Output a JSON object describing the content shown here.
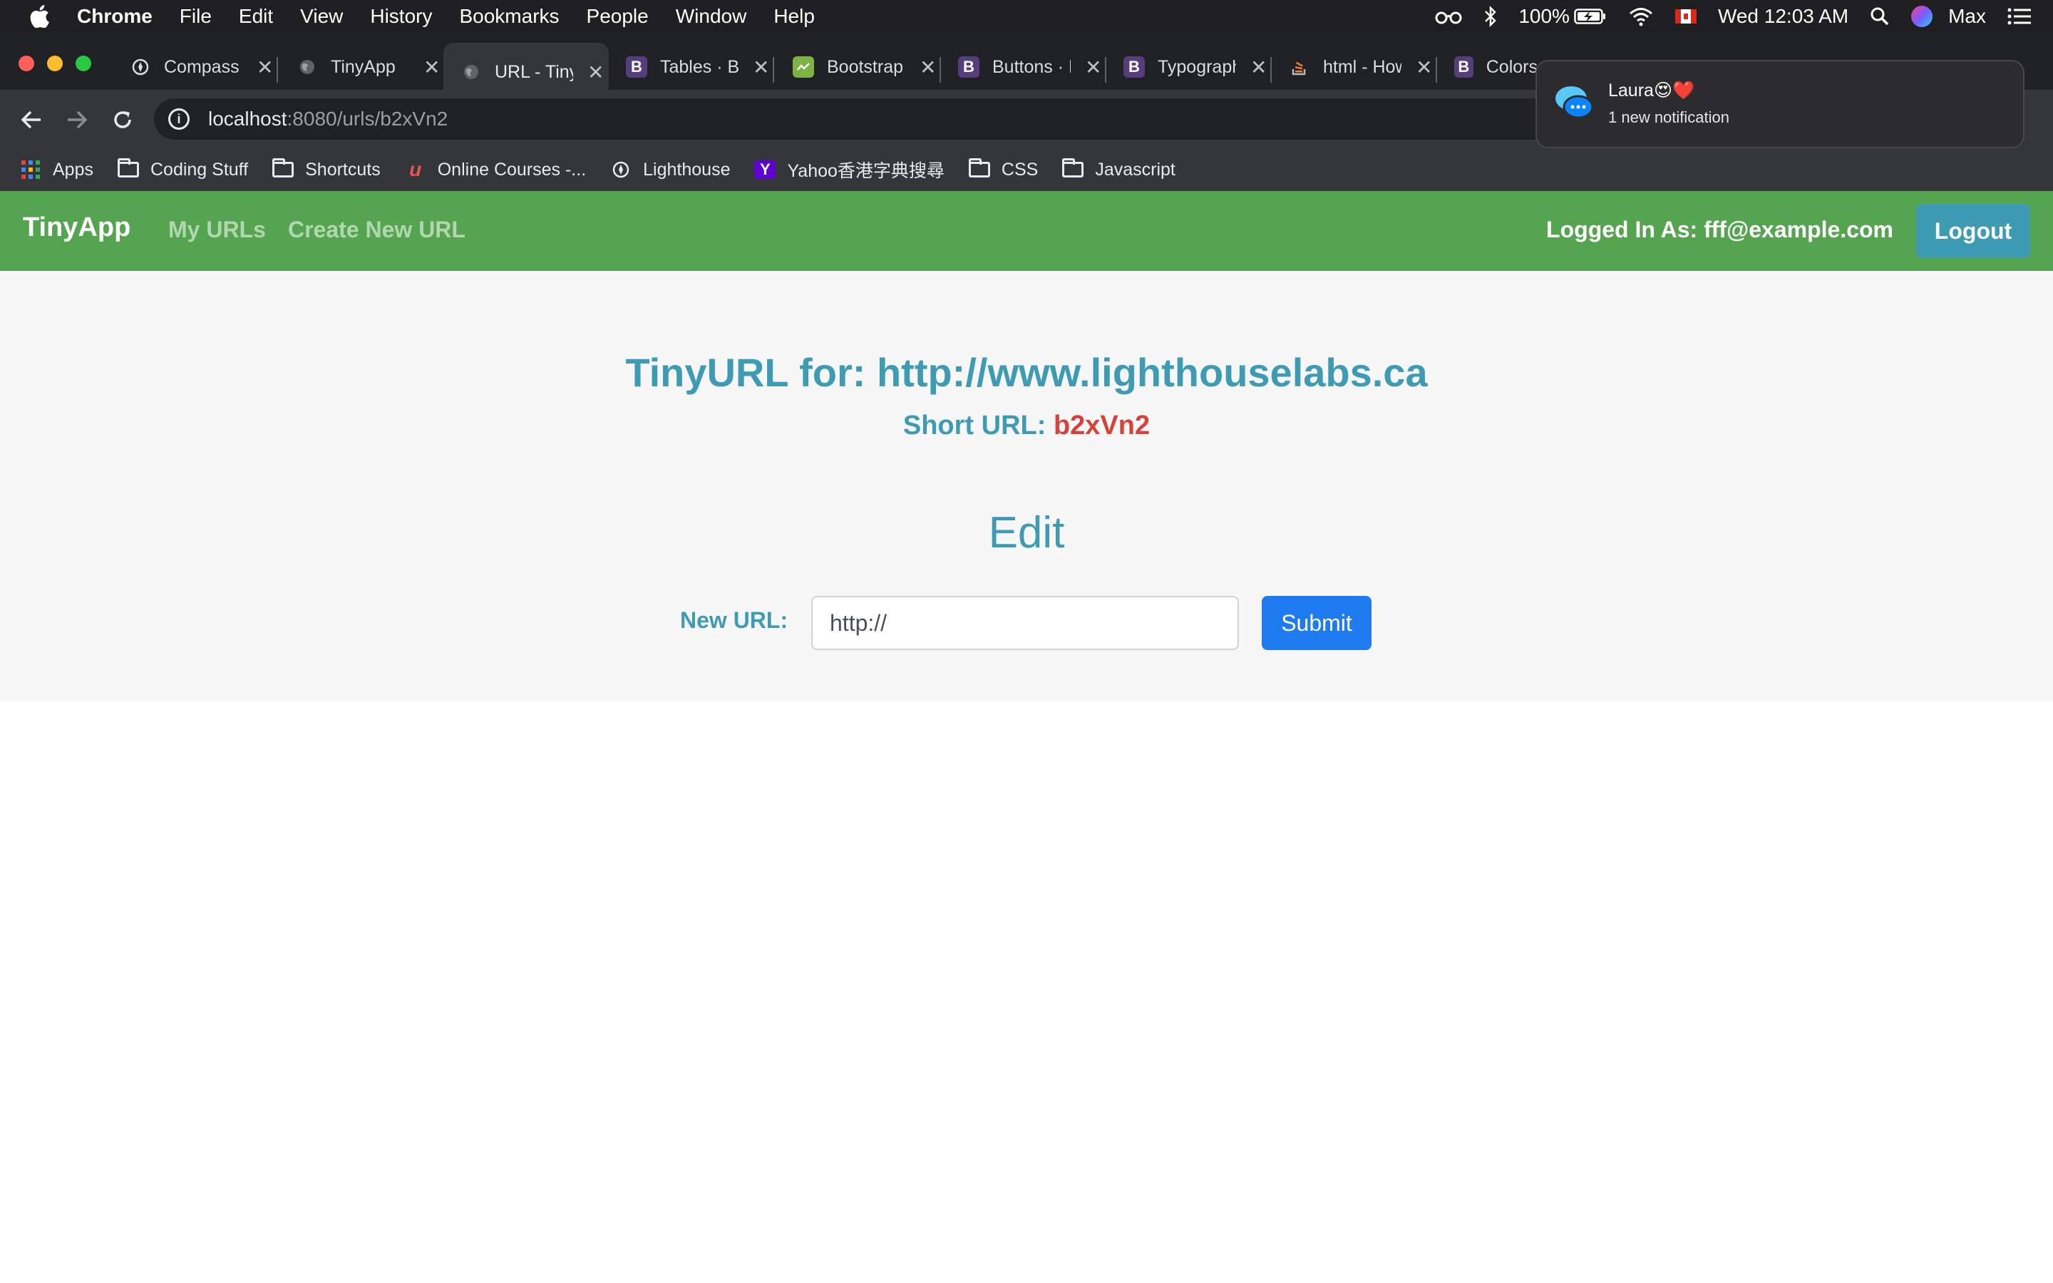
{
  "menubar": {
    "app": "Chrome",
    "items": [
      "File",
      "Edit",
      "View",
      "History",
      "Bookmarks",
      "People",
      "Window",
      "Help"
    ],
    "battery": "100%",
    "clock": "Wed 12:03 AM",
    "user": "Max"
  },
  "tabs": [
    {
      "label": "Compass",
      "icon": "compass-icon"
    },
    {
      "label": "TinyApp",
      "icon": "globe-icon"
    },
    {
      "label": "URL - TinyApp",
      "icon": "globe-icon"
    },
    {
      "label": "Tables · Bootstrap",
      "icon": "B"
    },
    {
      "label": "Bootstrap",
      "icon": "bootstrap-logo-icon"
    },
    {
      "label": "Buttons · Bootstrap",
      "icon": "B"
    },
    {
      "label": "Typography",
      "icon": "B"
    },
    {
      "label": "html - How",
      "icon": "stackoverflow-icon"
    },
    {
      "label": "Colors",
      "icon": "B"
    }
  ],
  "address": {
    "host": "localhost",
    "rest": ":8080/urls/b2xVn2"
  },
  "bookmarks": [
    {
      "label": "Apps",
      "icon": "apps-grid-icon"
    },
    {
      "label": "Coding Stuff",
      "icon": "folder-icon"
    },
    {
      "label": "Shortcuts",
      "icon": "folder-icon"
    },
    {
      "label": "Online Courses -...",
      "icon": "udemy-icon"
    },
    {
      "label": "Lighthouse",
      "icon": "compass-icon"
    },
    {
      "label": "Yahoo香港字典搜尋",
      "icon": "yahoo-icon"
    },
    {
      "label": "CSS",
      "icon": "folder-icon"
    },
    {
      "label": "Javascript",
      "icon": "folder-icon"
    }
  ],
  "notification": {
    "title": "Laura😍❤️",
    "body": "1 new notification"
  },
  "navbar": {
    "brand": "TinyApp",
    "links": [
      "My URLs",
      "Create New URL"
    ],
    "logged_in": "Logged In As: fff@example.com",
    "logout": "Logout"
  },
  "main": {
    "title": "TinyURL for: http://www.lighthouselabs.ca",
    "short_label": "Short URL:",
    "short_code": "b2xVn2",
    "edit_heading": "Edit",
    "form": {
      "label": "New URL:",
      "value": "http://",
      "submit": "Submit"
    }
  },
  "colors": {
    "navbar": "#55a44f",
    "accent": "#3d9bb4",
    "short_code": "#d9403a",
    "submit": "#1e7bf0"
  }
}
